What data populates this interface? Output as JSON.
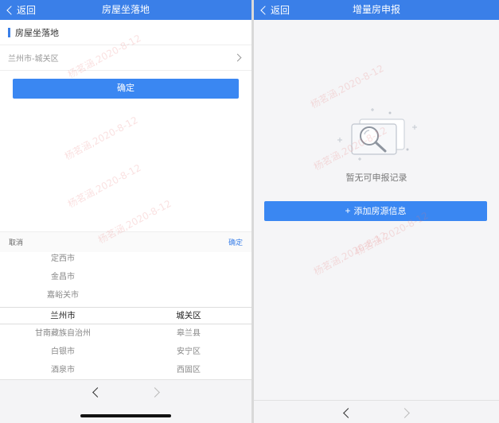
{
  "left": {
    "nav": {
      "back_label": "返回",
      "title": "房屋坐落地"
    },
    "section_title": "房屋坐落地",
    "location_value": "兰州市-城关区",
    "confirm_label": "确定",
    "picker": {
      "cancel_label": "取消",
      "ok_label": "确定",
      "column1": [
        "定西市",
        "金昌市",
        "嘉峪关市",
        "兰州市",
        "甘南藏族自治州",
        "白银市",
        "酒泉市"
      ],
      "column2": [
        "城关区",
        "皋兰县",
        "安宁区",
        "西固区"
      ]
    }
  },
  "right": {
    "nav": {
      "back_label": "返回",
      "title": "增量房申报"
    },
    "empty_text": "暂无可申报记录",
    "add_button": {
      "icon": "+",
      "label": "添加房源信息"
    }
  },
  "watermark_text": "杨茗涵,2020-8-12",
  "colors": {
    "primary": "#3a7fe8",
    "button": "#3a87f2",
    "background": "#f5f5f7"
  }
}
